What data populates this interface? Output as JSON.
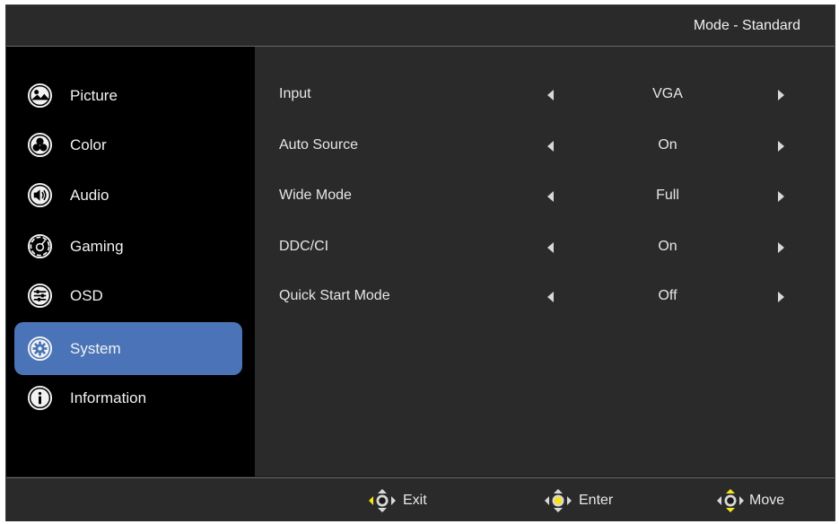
{
  "header": {
    "mode_label": "Mode - Standard"
  },
  "sidebar": {
    "items": [
      {
        "label": "Picture",
        "icon": "picture-icon",
        "selected": false
      },
      {
        "label": "Color",
        "icon": "color-icon",
        "selected": false
      },
      {
        "label": "Audio",
        "icon": "audio-icon",
        "selected": false
      },
      {
        "label": "Gaming",
        "icon": "gaming-icon",
        "selected": false
      },
      {
        "label": "OSD",
        "icon": "osd-icon",
        "selected": false
      },
      {
        "label": "System",
        "icon": "system-gear-icon",
        "selected": true
      },
      {
        "label": "Information",
        "icon": "information-icon",
        "selected": false
      }
    ]
  },
  "settings": {
    "rows": [
      {
        "label": "Input",
        "value": "VGA"
      },
      {
        "label": "Auto Source",
        "value": "On"
      },
      {
        "label": "Wide Mode",
        "value": "Full"
      },
      {
        "label": "DDC/CI",
        "value": "On"
      },
      {
        "label": "Quick Start Mode",
        "value": "Off"
      }
    ]
  },
  "footer": {
    "hints": [
      {
        "label": "Exit",
        "icon": "joystick-left-icon",
        "highlight": "left"
      },
      {
        "label": "Enter",
        "icon": "joystick-center-icon",
        "highlight": "center"
      },
      {
        "label": "Move",
        "icon": "joystick-updown-icon",
        "highlight": "updown"
      }
    ]
  },
  "colors": {
    "selected_background": "#4a74b7",
    "highlight": "#f5e51a",
    "panel": "#2a2a2a",
    "sidebar": "#000000"
  }
}
